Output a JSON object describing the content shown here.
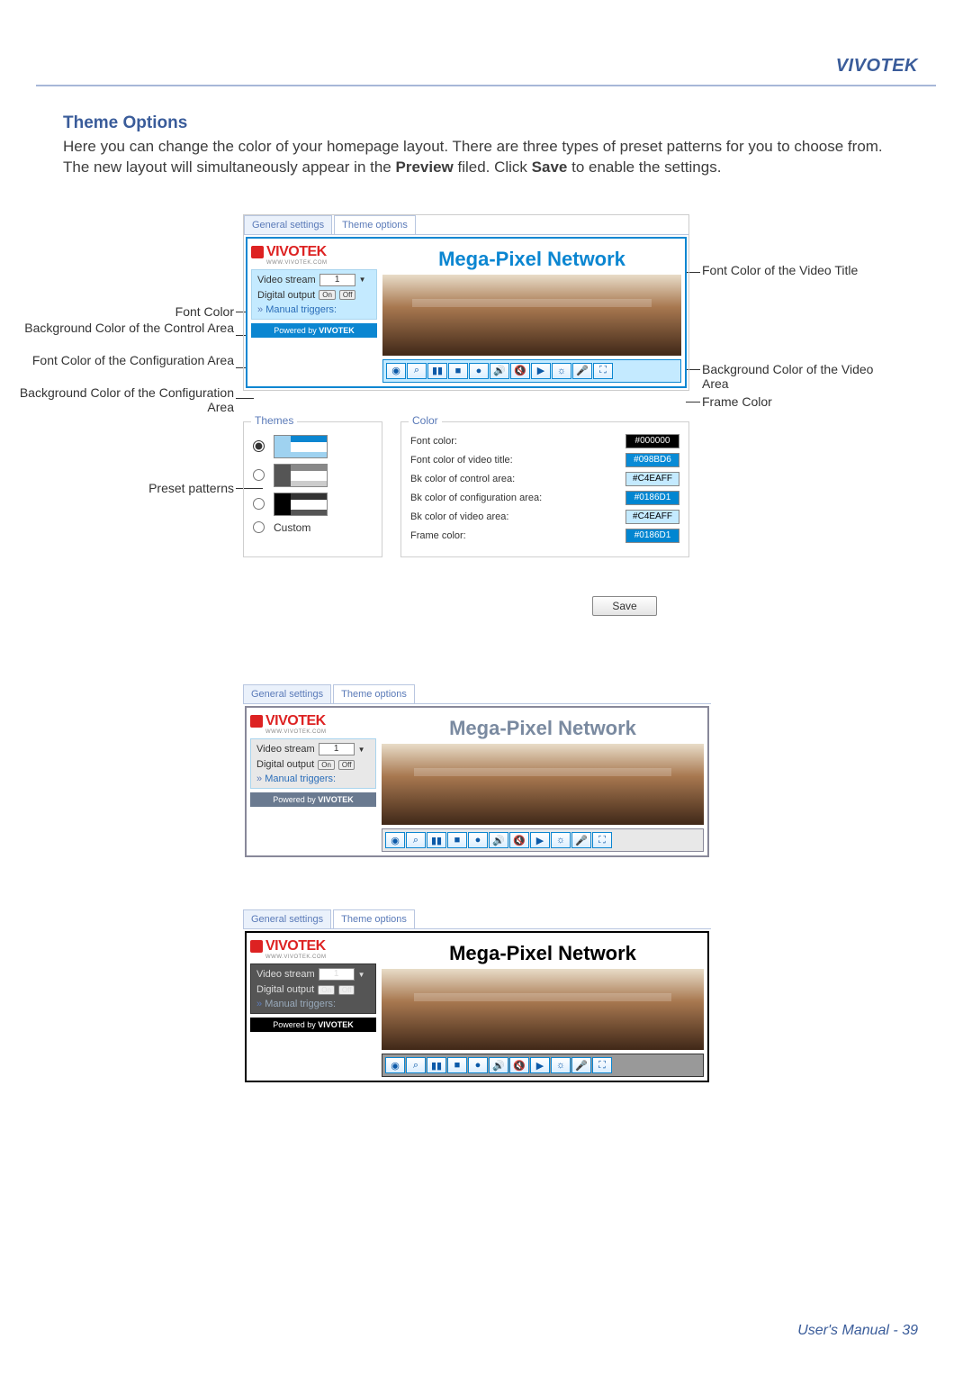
{
  "brand": "VIVOTEK",
  "section_title": "Theme Options",
  "intro_1": "Here you can change the color of your homepage layout. There are three types of preset patterns for you to choose from. The new layout will simultaneously appear in the ",
  "intro_preview": "Preview",
  "intro_2": " filed. Click ",
  "intro_save": "Save",
  "intro_3": " to enable the settings.",
  "tabs": {
    "general": "General settings",
    "theme": "Theme options"
  },
  "logo": {
    "text": "VIVOTEK",
    "sub": "WWW.VIVOTEK.COM"
  },
  "control": {
    "video_stream_label": "Video stream",
    "video_stream_value": "1",
    "digital_output_label": "Digital output",
    "on": "On",
    "off": "Off",
    "manual_triggers": "Manual triggers:"
  },
  "powered": "Powered by ",
  "powered_brand": "VIVOTEK",
  "video_title": "Mega-Pixel Network",
  "toolbar_icons": [
    "camera",
    "zoom",
    "pause",
    "stop",
    "record",
    "volume",
    "mute",
    "playfwd",
    "brightness",
    "mic",
    "fullscreen"
  ],
  "callouts": {
    "font_color": "Font Color",
    "bg_control": "Background Color of the Control Area",
    "font_config": "Font Color of the Configuration Area",
    "bg_config": "Background Color of the Configuration Area",
    "font_title": "Font Color of the Video Title",
    "bg_video": "Background Color of the Video Area",
    "frame_color": "Frame Color",
    "preset": "Preset patterns"
  },
  "themes": {
    "legend": "Themes",
    "custom": "Custom"
  },
  "colors": {
    "legend": "Color",
    "rows": [
      {
        "label": "Font color:",
        "value": "#000000",
        "bg": "#000000",
        "fg": "#ffffff"
      },
      {
        "label": "Font color of video title:",
        "value": "#098BD6",
        "bg": "#098BD6",
        "fg": "#ffffff"
      },
      {
        "label": "Bk color of control area:",
        "value": "#C4EAFF",
        "bg": "#C4EAFF",
        "fg": "#000000"
      },
      {
        "label": "Bk color of configuration area:",
        "value": "#0186D1",
        "bg": "#0186D1",
        "fg": "#ffffff"
      },
      {
        "label": "Bk color of video area:",
        "value": "#C4EAFF",
        "bg": "#C4EAFF",
        "fg": "#000000"
      },
      {
        "label": "Frame color:",
        "value": "#0186D1",
        "bg": "#0186D1",
        "fg": "#ffffff"
      }
    ]
  },
  "save": "Save",
  "footer": "User's Manual - 39"
}
